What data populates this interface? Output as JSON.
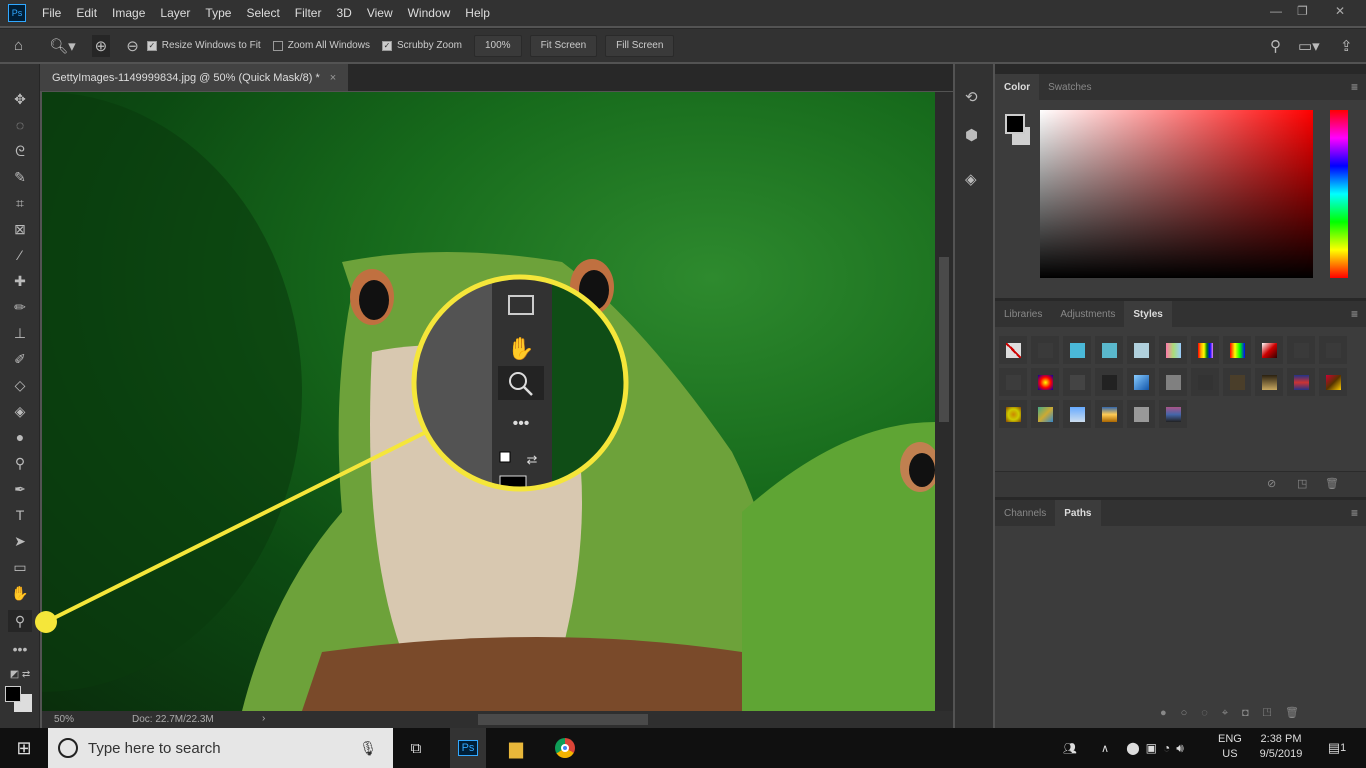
{
  "app": {
    "logo": "Ps",
    "menu": [
      "File",
      "Edit",
      "Image",
      "Layer",
      "Type",
      "Select",
      "Filter",
      "3D",
      "View",
      "Window",
      "Help"
    ]
  },
  "options": {
    "resize_windows": {
      "label": "Resize Windows to Fit",
      "checked": true
    },
    "zoom_all": {
      "label": "Zoom All Windows",
      "checked": false
    },
    "scrubby": {
      "label": "Scrubby Zoom",
      "checked": true
    },
    "zoom_100": "100%",
    "fit_screen": "Fit Screen",
    "fill_screen": "Fill Screen"
  },
  "document": {
    "tab_title": "GettyImages-1149999834.jpg @ 50% (Quick Mask/8) *",
    "close": "×"
  },
  "tools": [
    "move",
    "marquee",
    "lasso",
    "quick-selection",
    "crop",
    "frame",
    "eyedropper",
    "healing",
    "brush",
    "stamp",
    "history-brush",
    "eraser",
    "paint-bucket",
    "blur",
    "dodge",
    "pen",
    "type",
    "path-selection",
    "rectangle",
    "hand",
    "zoom",
    "more"
  ],
  "status": {
    "zoom": "50%",
    "doc": "Doc: 22.7M/22.3M"
  },
  "callout": {
    "color": "#f5e63a",
    "highlighted_tool": "zoom"
  },
  "color_panel": {
    "tabs": [
      "Color",
      "Swatches"
    ],
    "active": "Color",
    "foreground": "#000000",
    "background": "#d0d0d0",
    "hue": "#ff0000"
  },
  "styles_panel": {
    "tabs": [
      "Libraries",
      "Adjustments",
      "Styles"
    ],
    "active": "Styles",
    "swatches": [
      "none",
      "#3a3a3a",
      "#4ab8d8",
      "#5ab8cc",
      "#b0d0dc",
      "linear-gradient(90deg,#f7a,#ad7,#9cf)",
      "linear-gradient(90deg,red,orange,yellow,green,blue,violet)",
      "linear-gradient(90deg,#f00,#ff0,#0f0,#00f)",
      "linear-gradient(135deg,#fff,#c00,#300)",
      "#3a3a3a",
      "#3a3a3a",
      "#3c3c3c",
      "radial-gradient(#ff0,#f00,#00a)",
      "#444",
      "#222",
      "linear-gradient(135deg,#8cf,#15a)",
      "#808080",
      "#333",
      "#4a3e2a",
      "linear-gradient(#2a2010,#c8a860)",
      "linear-gradient(#238,#c33,#238)",
      "linear-gradient(135deg,#c03,#530,#fc0)",
      "radial-gradient(#c80,#cc0,#840)",
      "linear-gradient(135deg,#4a8,#ca3,#38c)",
      "linear-gradient(#6af,#cde)",
      "linear-gradient(#36a,#fc5,#a60)",
      "#999",
      "linear-gradient(#a58,#46a,#222)"
    ]
  },
  "paths_panel": {
    "tabs": [
      "Channels",
      "Paths"
    ],
    "active": "Paths"
  },
  "taskbar": {
    "search_placeholder": "Type here to search",
    "lang": "ENG",
    "region": "US",
    "time": "2:38 PM",
    "date": "9/5/2019",
    "notifications": "1"
  }
}
